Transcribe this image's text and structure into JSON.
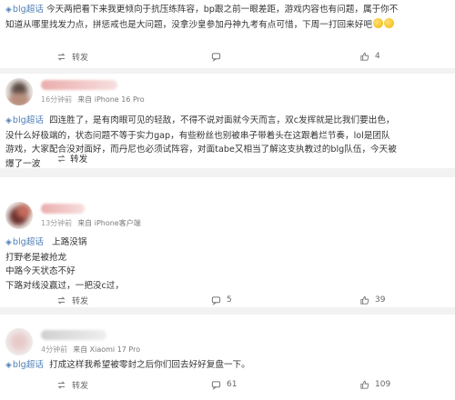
{
  "topic_label": "blg超话",
  "actions": {
    "repost_label": "转发"
  },
  "posts": [
    {
      "source": "",
      "time": "",
      "lines": [
        {
          "text": "今天两把看下来我更倾向于抗压练阵容，bp跟之前一眼差距，游戏内容也有问题，属于你不"
        },
        {
          "text": "知道从哪里找发力点，拼惩戒也是大问题，没拿沙皇参加丹神九考有点可惜，下周一打回来好吧"
        }
      ],
      "comments": "",
      "likes": "4"
    },
    {
      "time": "16分钟前",
      "source": "来自 iPhone 16 Pro",
      "lines": [
        {
          "text": "四连胜了，是有肉眼可见的轻敌，不得不说对面就今天而言，双c发挥就是比我们要出色，"
        },
        {
          "text": "没什么好极端的，状态问题不等于实力gap，有些粉丝也别被串子带着头在这跟着烂节奏，lol是团队"
        },
        {
          "text": "游戏，大家配合没对面好，而丹尼也必须试阵容，对面tabe又相当了解这支执教过的blg队伍，今天被"
        },
        {
          "text": "爆了一波"
        }
      ],
      "comments": "",
      "likes": ""
    },
    {
      "time": "13分钟前",
      "source": "来自 iPhone客户端",
      "lines": [
        {
          "text": "上路没锅"
        },
        {
          "text": "打野老是被抢龙"
        },
        {
          "text": "中路今天状态不好"
        },
        {
          "text": "下路对线没赢过，一把没c过，"
        }
      ],
      "comments": "5",
      "likes": "39"
    },
    {
      "time": "4分钟前",
      "source": "来自 Xiaomi 17 Pro",
      "lines": [
        {
          "text": "打成这样我希望被零封之后你们回去好好复盘一下。"
        }
      ],
      "comments": "61",
      "likes": "109"
    }
  ]
}
